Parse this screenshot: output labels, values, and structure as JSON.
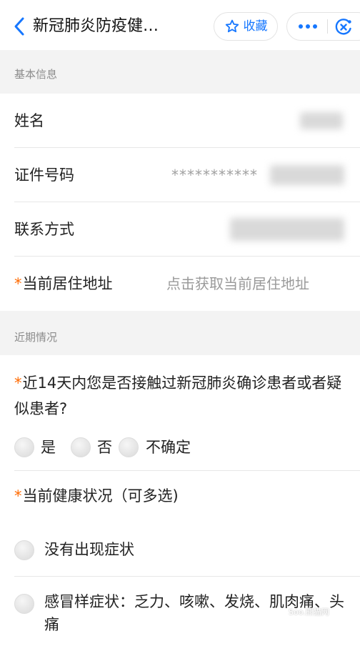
{
  "header": {
    "title": "新冠肺炎防疫健…",
    "favorite_label": "收藏",
    "icons": {
      "back": "chevron-left-icon",
      "favorite": "star-outline-icon",
      "more": "more-dots-icon",
      "close": "close-circle-icon"
    },
    "accent_color": "#1677ff"
  },
  "basic_info": {
    "section_title": "基本信息",
    "rows": [
      {
        "label": "姓名",
        "required": false,
        "value": ""
      },
      {
        "label": "证件号码",
        "required": false,
        "value": "***********"
      },
      {
        "label": "联系方式",
        "required": false,
        "value": ""
      },
      {
        "label": "当前居住地址",
        "required": true,
        "value": "点击获取当前居住地址"
      }
    ]
  },
  "recent": {
    "section_title": "近期情况",
    "q1": {
      "required_mark": "*",
      "text": "近14天内您是否接触过新冠肺炎确诊患者或者疑似患者?",
      "options": [
        "是",
        "否",
        "不确定"
      ]
    },
    "q2": {
      "required_mark": "*",
      "text": "当前健康状况（可多选)",
      "options": [
        "没有出现症状",
        "感冒样症状：乏力、咳嗽、发烧、肌肉痛、头痛"
      ]
    }
  },
  "required_color": "#ff6a00",
  "watermark": "Soo.熊猫网"
}
